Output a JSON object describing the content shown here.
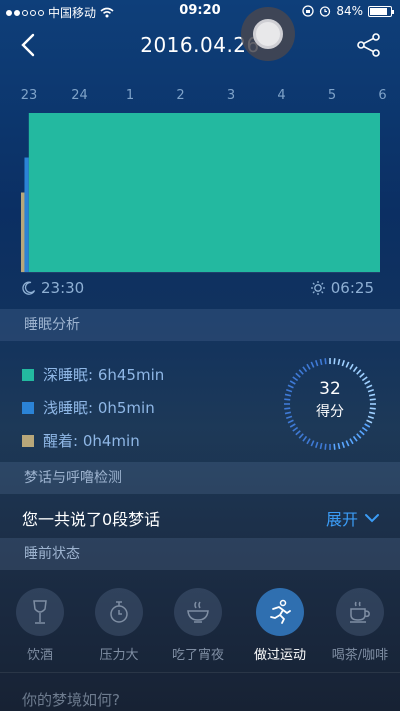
{
  "status_bar": {
    "carrier": "中国移动",
    "time": "09:20",
    "battery": "84%",
    "battery_level": 0.84
  },
  "nav": {
    "title": "2016.04.26"
  },
  "chart": {
    "hour_labels": [
      "23",
      "24",
      "1",
      "2",
      "3",
      "4",
      "5",
      "6"
    ],
    "bed_time": "23:30",
    "wake_time": "06:25"
  },
  "chart_data": {
    "type": "bar",
    "x_ticks": [
      "23",
      "24",
      "1",
      "2",
      "3",
      "4",
      "5",
      "6"
    ],
    "start": "23:30",
    "end": "06:25",
    "series": [
      {
        "name": "醒着",
        "color": "#b8a77a",
        "minutes": 4
      },
      {
        "name": "浅睡眠",
        "color": "#2b83d6",
        "minutes": 5
      },
      {
        "name": "深睡眠",
        "color": "#23b9a0",
        "minutes": 405
      }
    ]
  },
  "sections": {
    "analysis": "睡眠分析",
    "sleeptalk": "梦话与呼噜检测",
    "pre_sleep": "睡前状态"
  },
  "analysis": {
    "items": [
      {
        "label": "深睡眠: 6h45min",
        "color": "#23b9a0"
      },
      {
        "label": "浅睡眠: 0h5min",
        "color": "#2b83d6"
      },
      {
        "label": "醒着: 0h4min",
        "color": "#b8a77a"
      }
    ],
    "score": "32",
    "score_unit": "得分",
    "score_fraction": 0.32
  },
  "sleeptalk": {
    "text": "您一共说了0段梦话",
    "expand_label": "展开"
  },
  "activities": [
    {
      "label": "饮酒",
      "icon": "wine-glass-icon",
      "active": false
    },
    {
      "label": "压力大",
      "icon": "stopwatch-icon",
      "active": false
    },
    {
      "label": "吃了宵夜",
      "icon": "bowl-icon",
      "active": false
    },
    {
      "label": "做过运动",
      "icon": "running-icon",
      "active": true
    },
    {
      "label": "喝茶/咖啡",
      "icon": "coffee-cup-icon",
      "active": false
    }
  ],
  "dream": {
    "question": "你的梦境如何?"
  }
}
